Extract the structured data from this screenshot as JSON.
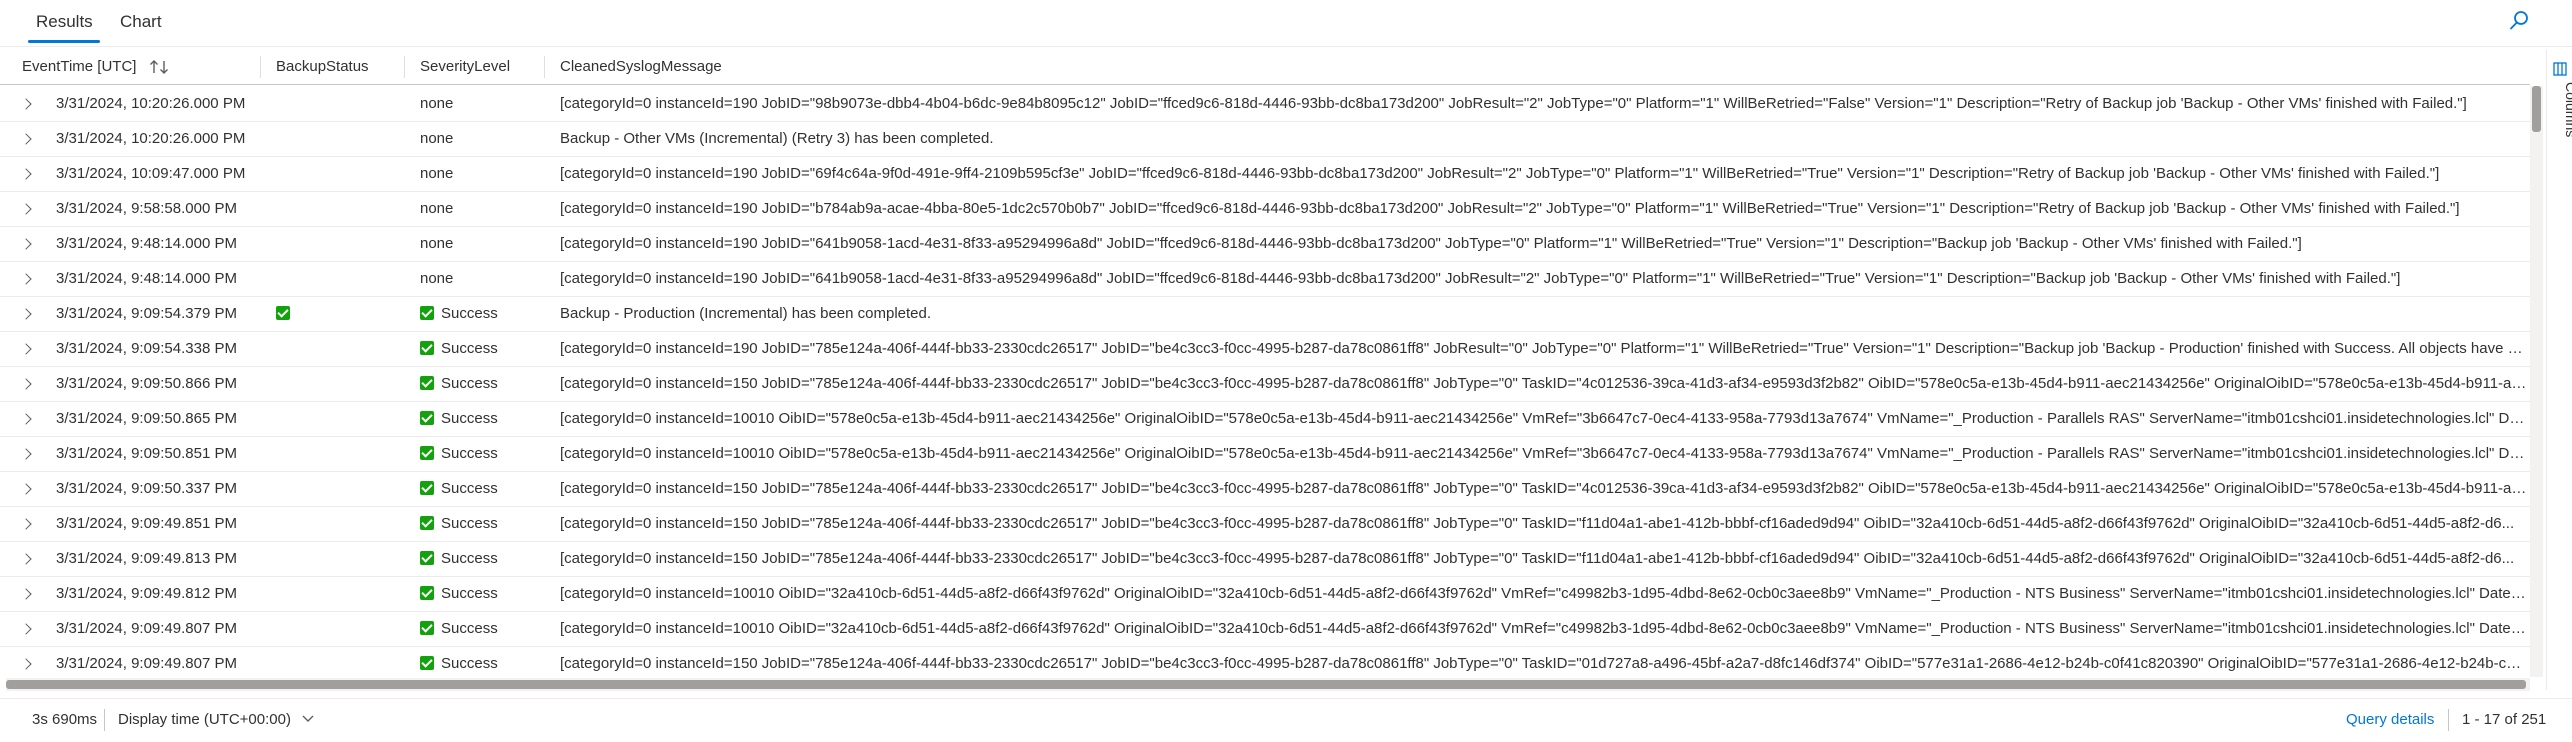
{
  "tabs": [
    {
      "label": "Results",
      "active": true
    },
    {
      "label": "Chart",
      "active": false
    }
  ],
  "columns": [
    "EventTime [UTC]",
    "BackupStatus",
    "SeverityLevel",
    "CleanedSyslogMessage"
  ],
  "rows": [
    {
      "time": "3/31/2024, 10:20:26.000 PM",
      "backup_status": "",
      "severity": "none",
      "message": "[categoryId=0 instanceId=190 JobID=\"98b9073e-dbb4-4b04-b6dc-9e84b8095c12\" JobID=\"ffced9c6-818d-4446-93bb-dc8ba173d200\" JobResult=\"2\" JobType=\"0\" Platform=\"1\" WillBeRetried=\"False\" Version=\"1\" Description=\"Retry of Backup job 'Backup - Other VMs' finished with Failed.\"]"
    },
    {
      "time": "3/31/2024, 10:20:26.000 PM",
      "backup_status": "",
      "severity": "none",
      "message": "Backup - Other VMs (Incremental) (Retry 3) has been completed."
    },
    {
      "time": "3/31/2024, 10:09:47.000 PM",
      "backup_status": "",
      "severity": "none",
      "message": "[categoryId=0 instanceId=190 JobID=\"69f4c64a-9f0d-491e-9ff4-2109b595cf3e\" JobID=\"ffced9c6-818d-4446-93bb-dc8ba173d200\" JobResult=\"2\" JobType=\"0\" Platform=\"1\" WillBeRetried=\"True\" Version=\"1\" Description=\"Retry of Backup job 'Backup - Other VMs' finished with Failed.\"]"
    },
    {
      "time": "3/31/2024, 9:58:58.000 PM",
      "backup_status": "",
      "severity": "none",
      "message": "[categoryId=0 instanceId=190 JobID=\"b784ab9a-acae-4bba-80e5-1dc2c570b0b7\" JobID=\"ffced9c6-818d-4446-93bb-dc8ba173d200\" JobResult=\"2\" JobType=\"0\" Platform=\"1\" WillBeRetried=\"True\" Version=\"1\" Description=\"Retry of Backup job 'Backup - Other VMs' finished with Failed.\"]"
    },
    {
      "time": "3/31/2024, 9:48:14.000 PM",
      "backup_status": "",
      "severity": "none",
      "message": "[categoryId=0 instanceId=190 JobID=\"641b9058-1acd-4e31-8f33-a95294996a8d\" JobID=\"ffced9c6-818d-4446-93bb-dc8ba173d200\" JobType=\"0\" Platform=\"1\" WillBeRetried=\"True\" Version=\"1\" Description=\"Backup job 'Backup - Other VMs' finished with Failed.\"]"
    },
    {
      "time": "3/31/2024, 9:48:14.000 PM",
      "backup_status": "",
      "severity": "none",
      "message": "[categoryId=0 instanceId=190 JobID=\"641b9058-1acd-4e31-8f33-a95294996a8d\" JobID=\"ffced9c6-818d-4446-93bb-dc8ba173d200\" JobResult=\"2\" JobType=\"0\" Platform=\"1\" WillBeRetried=\"True\" Version=\"1\" Description=\"Backup job 'Backup - Other VMs' finished with Failed.\"]"
    },
    {
      "time": "3/31/2024, 9:09:54.379 PM",
      "backup_status": "check",
      "severity": "Success",
      "message": "Backup - Production (Incremental) has been completed."
    },
    {
      "time": "3/31/2024, 9:09:54.338 PM",
      "backup_status": "",
      "severity": "Success",
      "message": "[categoryId=0 instanceId=190 JobID=\"785e124a-406f-444f-bb33-2330cdc26517\" JobID=\"be4c3cc3-f0cc-4995-b287-da78c0861ff8\" JobResult=\"0\" JobType=\"0\" Platform=\"1\" WillBeRetried=\"True\" Version=\"1\" Description=\"Backup job 'Backup - Production' finished with Success. All objects have b..."
    },
    {
      "time": "3/31/2024, 9:09:50.866 PM",
      "backup_status": "",
      "severity": "Success",
      "message": "[categoryId=0 instanceId=150 JobID=\"785e124a-406f-444f-bb33-2330cdc26517\" JobID=\"be4c3cc3-f0cc-4995-b287-da78c0861ff8\" JobType=\"0\" TaskID=\"4c012536-39ca-41d3-af34-e9593d3f2b82\" OibID=\"578e0c5a-e13b-45d4-b911-aec21434256e\" OriginalOibID=\"578e0c5a-e13b-45d4-b911-ae..."
    },
    {
      "time": "3/31/2024, 9:09:50.865 PM",
      "backup_status": "",
      "severity": "Success",
      "message": "[categoryId=0 instanceId=10010 OibID=\"578e0c5a-e13b-45d4-b911-aec21434256e\" OriginalOibID=\"578e0c5a-e13b-45d4-b911-aec21434256e\" VmRef=\"3b6647c7-0ec4-4133-958a-7793d13a7674\" VmName=\"_Production - Parallels RAS\" ServerName=\"itmb01cshci01.insidetechnologies.lcl\" Date..."
    },
    {
      "time": "3/31/2024, 9:09:50.851 PM",
      "backup_status": "",
      "severity": "Success",
      "message": "[categoryId=0 instanceId=10010 OibID=\"578e0c5a-e13b-45d4-b911-aec21434256e\" OriginalOibID=\"578e0c5a-e13b-45d4-b911-aec21434256e\" VmRef=\"3b6647c7-0ec4-4133-958a-7793d13a7674\" VmName=\"_Production - Parallels RAS\" ServerName=\"itmb01cshci01.insidetechnologies.lcl\" Date..."
    },
    {
      "time": "3/31/2024, 9:09:50.337 PM",
      "backup_status": "",
      "severity": "Success",
      "message": "[categoryId=0 instanceId=150 JobID=\"785e124a-406f-444f-bb33-2330cdc26517\" JobID=\"be4c3cc3-f0cc-4995-b287-da78c0861ff8\" JobType=\"0\" TaskID=\"4c012536-39ca-41d3-af34-e9593d3f2b82\" OibID=\"578e0c5a-e13b-45d4-b911-aec21434256e\" OriginalOibID=\"578e0c5a-e13b-45d4-b911-ae..."
    },
    {
      "time": "3/31/2024, 9:09:49.851 PM",
      "backup_status": "",
      "severity": "Success",
      "message": "[categoryId=0 instanceId=150 JobID=\"785e124a-406f-444f-bb33-2330cdc26517\" JobID=\"be4c3cc3-f0cc-4995-b287-da78c0861ff8\" JobType=\"0\" TaskID=\"f11d04a1-abe1-412b-bbbf-cf16aded9d94\" OibID=\"32a410cb-6d51-44d5-a8f2-d66f43f9762d\" OriginalOibID=\"32a410cb-6d51-44d5-a8f2-d6..."
    },
    {
      "time": "3/31/2024, 9:09:49.813 PM",
      "backup_status": "",
      "severity": "Success",
      "message": "[categoryId=0 instanceId=150 JobID=\"785e124a-406f-444f-bb33-2330cdc26517\" JobID=\"be4c3cc3-f0cc-4995-b287-da78c0861ff8\" JobType=\"0\" TaskID=\"f11d04a1-abe1-412b-bbbf-cf16aded9d94\" OibID=\"32a410cb-6d51-44d5-a8f2-d66f43f9762d\" OriginalOibID=\"32a410cb-6d51-44d5-a8f2-d6..."
    },
    {
      "time": "3/31/2024, 9:09:49.812 PM",
      "backup_status": "",
      "severity": "Success",
      "message": "[categoryId=0 instanceId=10010 OibID=\"32a410cb-6d51-44d5-a8f2-d66f43f9762d\" OriginalOibID=\"32a410cb-6d51-44d5-a8f2-d66f43f9762d\" VmRef=\"c49982b3-1d95-4dbd-8e62-0cb0c3aee8b9\" VmName=\"_Production - NTS Business\" ServerName=\"itmb01cshci01.insidetechnologies.lcl\" DateTi..."
    },
    {
      "time": "3/31/2024, 9:09:49.807 PM",
      "backup_status": "",
      "severity": "Success",
      "message": "[categoryId=0 instanceId=10010 OibID=\"32a410cb-6d51-44d5-a8f2-d66f43f9762d\" OriginalOibID=\"32a410cb-6d51-44d5-a8f2-d66f43f9762d\" VmRef=\"c49982b3-1d95-4dbd-8e62-0cb0c3aee8b9\" VmName=\"_Production - NTS Business\" ServerName=\"itmb01cshci01.insidetechnologies.lcl\" DateTi..."
    },
    {
      "time": "3/31/2024, 9:09:49.807 PM",
      "backup_status": "",
      "severity": "Success",
      "message": "[categoryId=0 instanceId=150 JobID=\"785e124a-406f-444f-bb33-2330cdc26517\" JobID=\"be4c3cc3-f0cc-4995-b287-da78c0861ff8\" JobType=\"0\" TaskID=\"01d727a8-a496-45bf-a2a7-d8fc146df374\" OibID=\"577e31a1-2686-4e12-b24b-c0f41c820390\" OriginalOibID=\"577e31a1-2686-4e12-b24b-c0f..."
    }
  ],
  "side_panel": {
    "label": "Columns",
    "icon": "columns-icon"
  },
  "footer": {
    "duration": "3s 690ms",
    "display_time": "Display time (UTC+00:00)",
    "query_details": "Query details",
    "pagination": "1 - 17 of 251"
  },
  "colors": {
    "accent": "#0078d4",
    "success": "#13a10e"
  }
}
